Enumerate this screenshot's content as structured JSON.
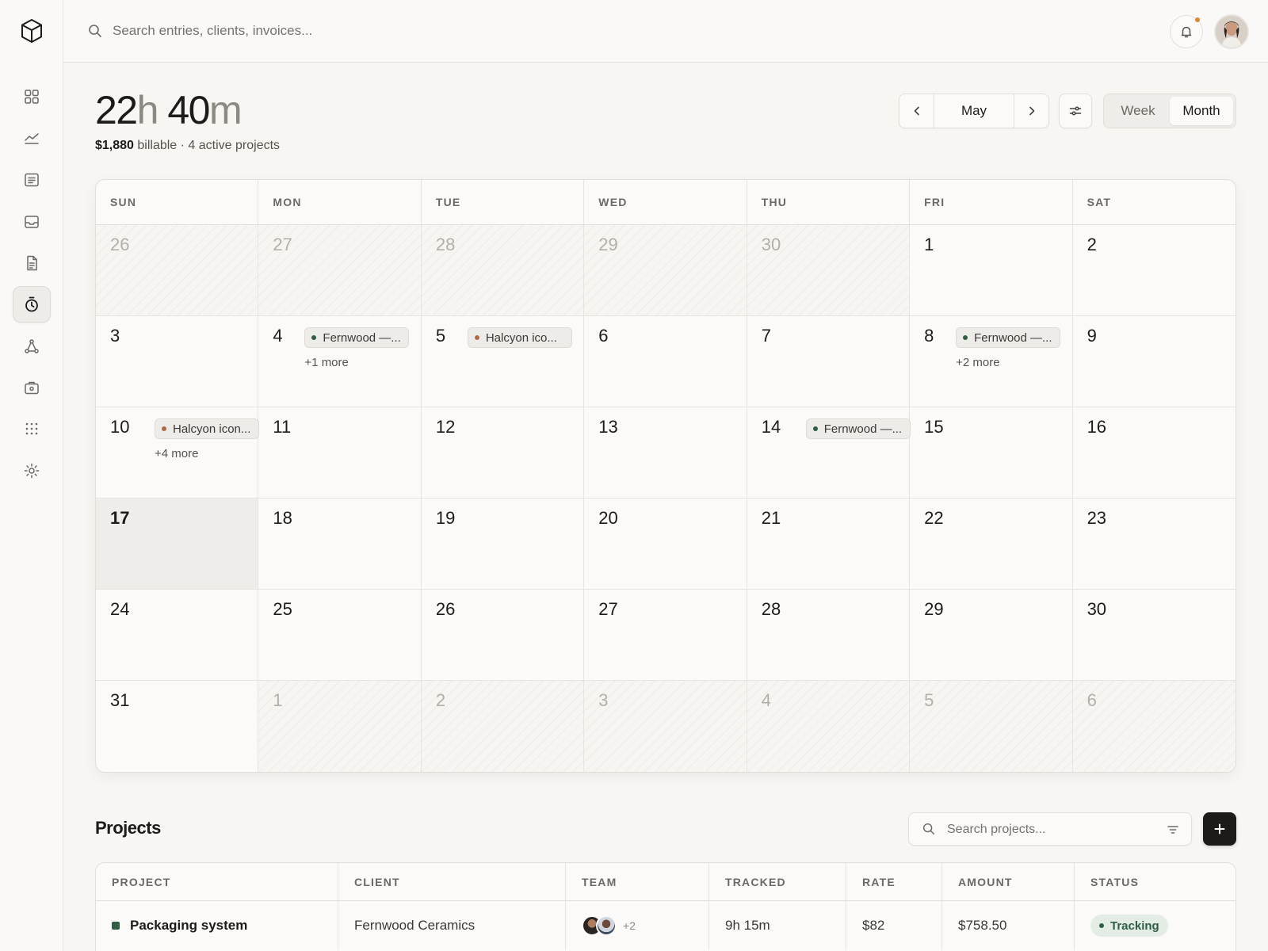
{
  "search": {
    "placeholder": "Search entries, clients, invoices..."
  },
  "header": {
    "total_hours": "22",
    "hours_unit": "h",
    "total_minutes": "40",
    "minutes_unit": "m",
    "billable": "$1,880",
    "billable_suffix": "billable · 4 active projects"
  },
  "controls": {
    "month": "May",
    "views": [
      "Week",
      "Month"
    ],
    "active_view": "Month"
  },
  "calendar": {
    "weekdays": [
      "SUN",
      "MON",
      "TUE",
      "WED",
      "THU",
      "FRI",
      "SAT"
    ],
    "today": 17,
    "cells": [
      {
        "day": "26",
        "outside": true
      },
      {
        "day": "27",
        "outside": true
      },
      {
        "day": "28",
        "outside": true
      },
      {
        "day": "29",
        "outside": true
      },
      {
        "day": "30",
        "outside": true
      },
      {
        "day": "1"
      },
      {
        "day": "2"
      },
      {
        "day": "3"
      },
      {
        "day": "4",
        "entry": {
          "label": "Fernwood —...",
          "color": "#2f5e44"
        },
        "more": "+1 more"
      },
      {
        "day": "5",
        "entry": {
          "label": "Halcyon ico...",
          "color": "#b06a4a"
        }
      },
      {
        "day": "6"
      },
      {
        "day": "7"
      },
      {
        "day": "8",
        "entry": {
          "label": "Fernwood —...",
          "color": "#2f5e44"
        },
        "more": "+2 more"
      },
      {
        "day": "9"
      },
      {
        "day": "10",
        "entry": {
          "label": "Halcyon icon...",
          "color": "#b06a4a"
        },
        "more": "+4 more"
      },
      {
        "day": "11"
      },
      {
        "day": "12"
      },
      {
        "day": "13"
      },
      {
        "day": "14",
        "entry": {
          "label": "Fernwood —...",
          "color": "#2f5e44"
        }
      },
      {
        "day": "15"
      },
      {
        "day": "16"
      },
      {
        "day": "17",
        "today": true
      },
      {
        "day": "18"
      },
      {
        "day": "19"
      },
      {
        "day": "20"
      },
      {
        "day": "21"
      },
      {
        "day": "22"
      },
      {
        "day": "23"
      },
      {
        "day": "24"
      },
      {
        "day": "25"
      },
      {
        "day": "26"
      },
      {
        "day": "27"
      },
      {
        "day": "28"
      },
      {
        "day": "29"
      },
      {
        "day": "30"
      },
      {
        "day": "31"
      },
      {
        "day": "1",
        "outside": true
      },
      {
        "day": "2",
        "outside": true
      },
      {
        "day": "3",
        "outside": true
      },
      {
        "day": "4",
        "outside": true
      },
      {
        "day": "5",
        "outside": true
      },
      {
        "day": "6",
        "outside": true
      }
    ]
  },
  "projects": {
    "title": "Projects",
    "search_placeholder": "Search projects...",
    "columns": [
      "PROJECT",
      "CLIENT",
      "TEAM",
      "TRACKED",
      "RATE",
      "AMOUNT",
      "STATUS"
    ],
    "rows": [
      {
        "name": "Packaging system",
        "color": "#2f5e44",
        "client": "Fernwood Ceramics",
        "team_more": "+2",
        "tracked": "9h 15m",
        "rate": "$82",
        "amount": "$758.50",
        "status": "Tracking"
      }
    ]
  },
  "icons": {
    "sidebar": [
      "dashboard-icon",
      "chart-icon",
      "document-list-icon",
      "inbox-icon",
      "file-icon",
      "timer-icon",
      "network-icon",
      "briefcase-icon",
      "apps-grid-icon",
      "settings-icon"
    ],
    "active_sidebar": "timer-icon"
  }
}
